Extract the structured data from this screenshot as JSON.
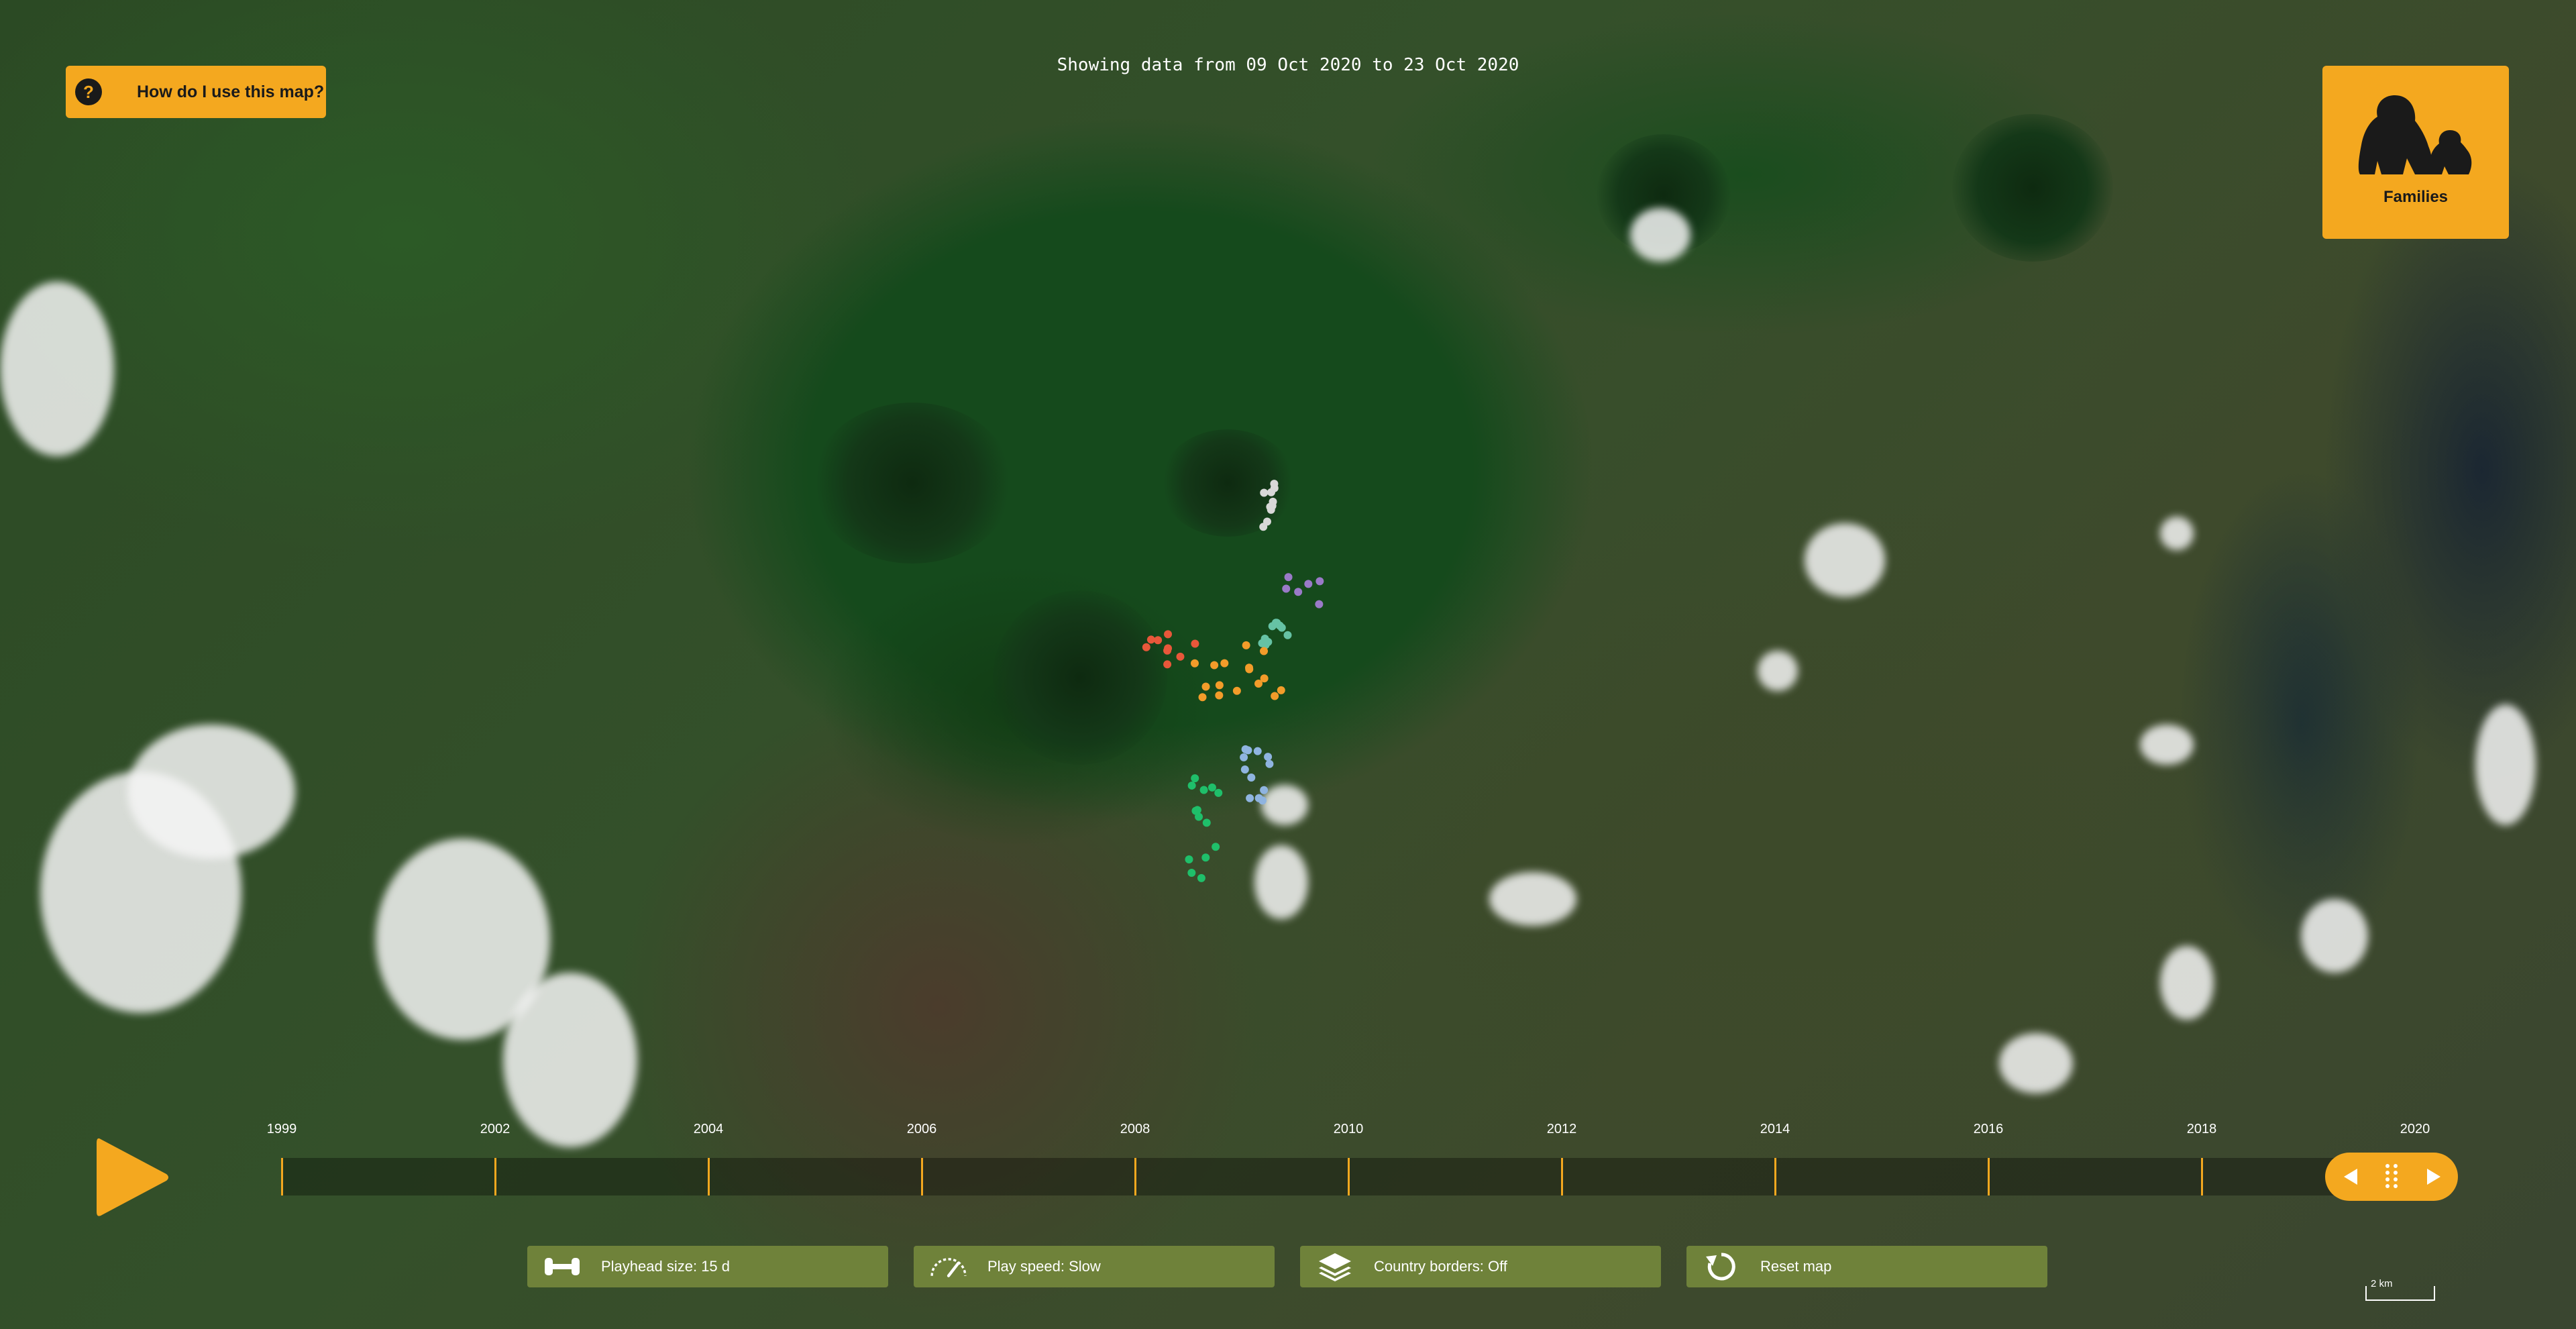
{
  "help_button": {
    "label": "How do I use this map?",
    "icon": "question-icon"
  },
  "date_range": "Showing data from 09 Oct 2020 to 23 Oct 2020",
  "families_button": {
    "label": "Families",
    "icon": "gorilla-icon"
  },
  "timeline": {
    "years": [
      "1999",
      "2002",
      "2004",
      "2006",
      "2008",
      "2010",
      "2012",
      "2014",
      "2016",
      "2018",
      "2020"
    ],
    "accent": "#f4a81f"
  },
  "controls": [
    {
      "id": "playhead-size",
      "label": "Playhead size: 15 d",
      "icon": "arrows-horizontal-icon"
    },
    {
      "id": "play-speed",
      "label": "Play speed: Slow",
      "icon": "speedometer-icon"
    },
    {
      "id": "country-borders",
      "label": "Country borders: Off",
      "icon": "layers-icon"
    },
    {
      "id": "reset-map",
      "label": "Reset map",
      "icon": "reset-icon"
    }
  ],
  "scale_label": "2 km",
  "gorilla_points": [
    {
      "group": "white",
      "color": "#d8d8d8",
      "count": 10
    },
    {
      "group": "purple",
      "color": "#9a7ac8",
      "count": 6
    },
    {
      "group": "teal",
      "color": "#66c2a5",
      "count": 10
    },
    {
      "group": "red",
      "color": "#e8573a",
      "count": 9
    },
    {
      "group": "orange",
      "color": "#f39c2a",
      "count": 16
    },
    {
      "group": "blue",
      "color": "#8fb4e0",
      "count": 12
    },
    {
      "group": "green",
      "color": "#1fbf6a",
      "count": 14
    }
  ]
}
